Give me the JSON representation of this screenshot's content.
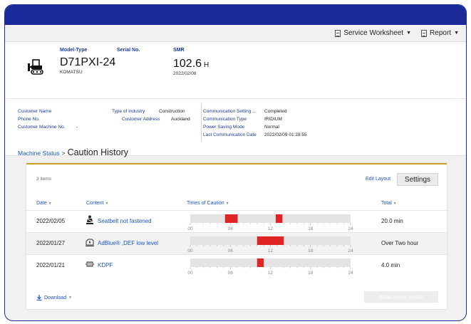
{
  "toolbar": {
    "service_worksheet": "Service Worksheet",
    "report": "Report"
  },
  "machine": {
    "model_type_label": "Model-Type",
    "serial_label": "Serial No.",
    "smr_label": "SMR",
    "model": "D71PXI-24",
    "maker": "KOMATSU",
    "serial": "",
    "smr_value": "102.6",
    "smr_unit": "H",
    "smr_date": "2022/02/08"
  },
  "info": {
    "customer_name_label": "Customer Name",
    "phone_label": "Phone No.",
    "customer_machine_label": "Customer Machine No.",
    "customer_machine_value": "-",
    "industry_label": "Type of Industry",
    "industry_value": "Construction",
    "address_label": "Customer Address",
    "address_value": "Auckland",
    "comm_setting_label": "Communication Setting ...",
    "comm_setting_value": "Completed",
    "comm_type_label": "Communication Type",
    "comm_type_value": "IRIDIUM",
    "power_saving_label": "Power Saving Mode",
    "power_saving_value": "Normal",
    "last_comm_label": "Last Communication Date",
    "last_comm_value": "2022/02/09 01:28:55"
  },
  "breadcrumb": {
    "link": "Machine Status",
    "separator": ">",
    "title": "Caution History"
  },
  "table": {
    "count": "3 items",
    "edit_layout": "Edit Layout",
    "settings": "Settings",
    "headers": {
      "date": "Date",
      "content": "Content",
      "times": "Times of Caution",
      "total": "Total"
    },
    "tick_labels": [
      "00",
      "06",
      "12",
      "18",
      "24"
    ],
    "bar_color": "#e02424",
    "rows": [
      {
        "date": "2022/02/05",
        "icon": "seatbelt-icon",
        "content": "Seatbelt not fastened",
        "total": "20.0 min",
        "intervals_hours": [
          [
            5.2,
            7.1
          ],
          [
            12.8,
            13.8
          ]
        ]
      },
      {
        "date": "2022/01/27",
        "icon": "adblue-icon",
        "content": "AdBlue® ,DEF low level",
        "total": "Over Two hour",
        "intervals_hours": [
          [
            10.0,
            14.0
          ]
        ]
      },
      {
        "date": "2022/01/21",
        "icon": "kdpf-icon",
        "content": "KDPF",
        "total": "4.0 min",
        "intervals_hours": [
          [
            10.0,
            11.0
          ]
        ]
      }
    ],
    "download": "Download",
    "show_more": "Show more results"
  }
}
